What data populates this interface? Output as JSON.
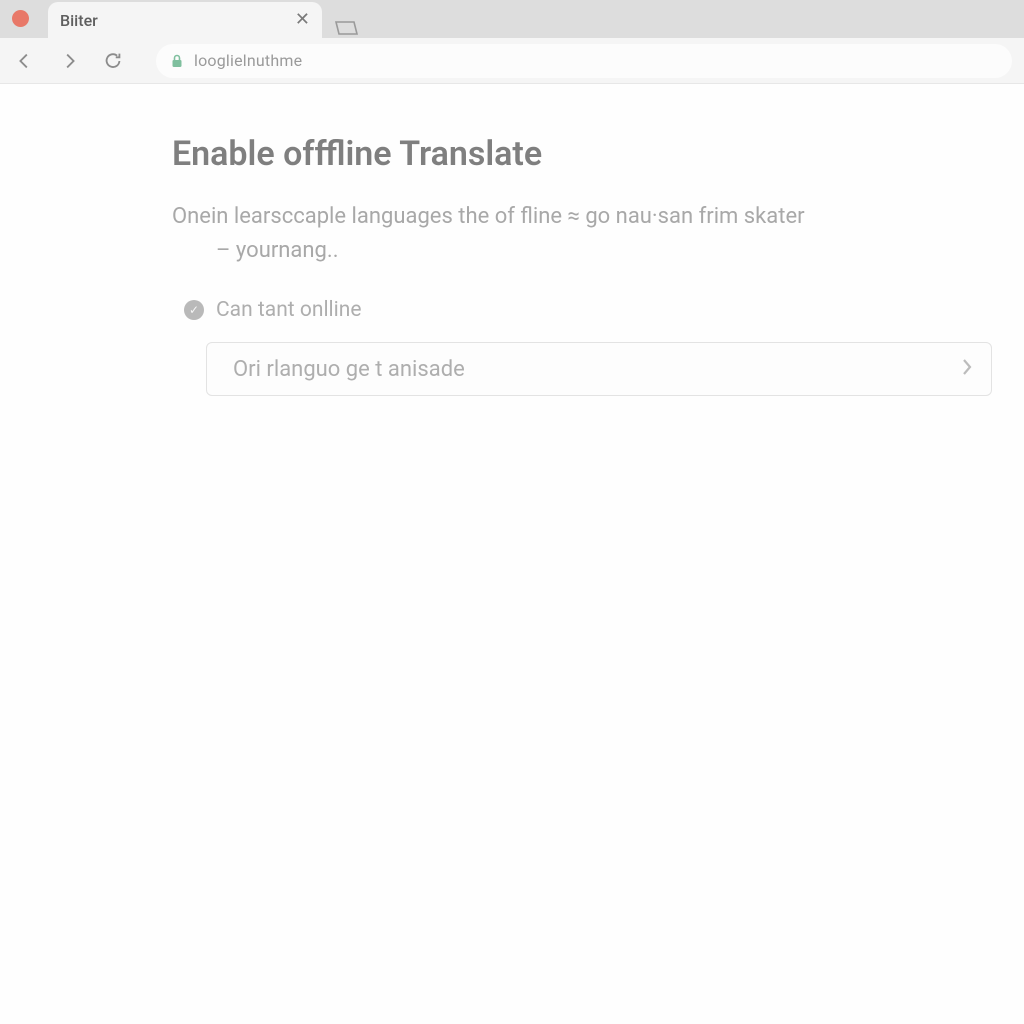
{
  "tab": {
    "title": "Biiter"
  },
  "address_bar": {
    "url": "looglielnuthme"
  },
  "page": {
    "heading": "Enable offfline Translate",
    "description_line1": "Onein learsccaple languages the of fline ≈ go nau·san frim skater",
    "description_line2": "– yournang..",
    "status_text": "Can tant onlline",
    "option_label": "Ori rlanguo ge t anisade"
  }
}
